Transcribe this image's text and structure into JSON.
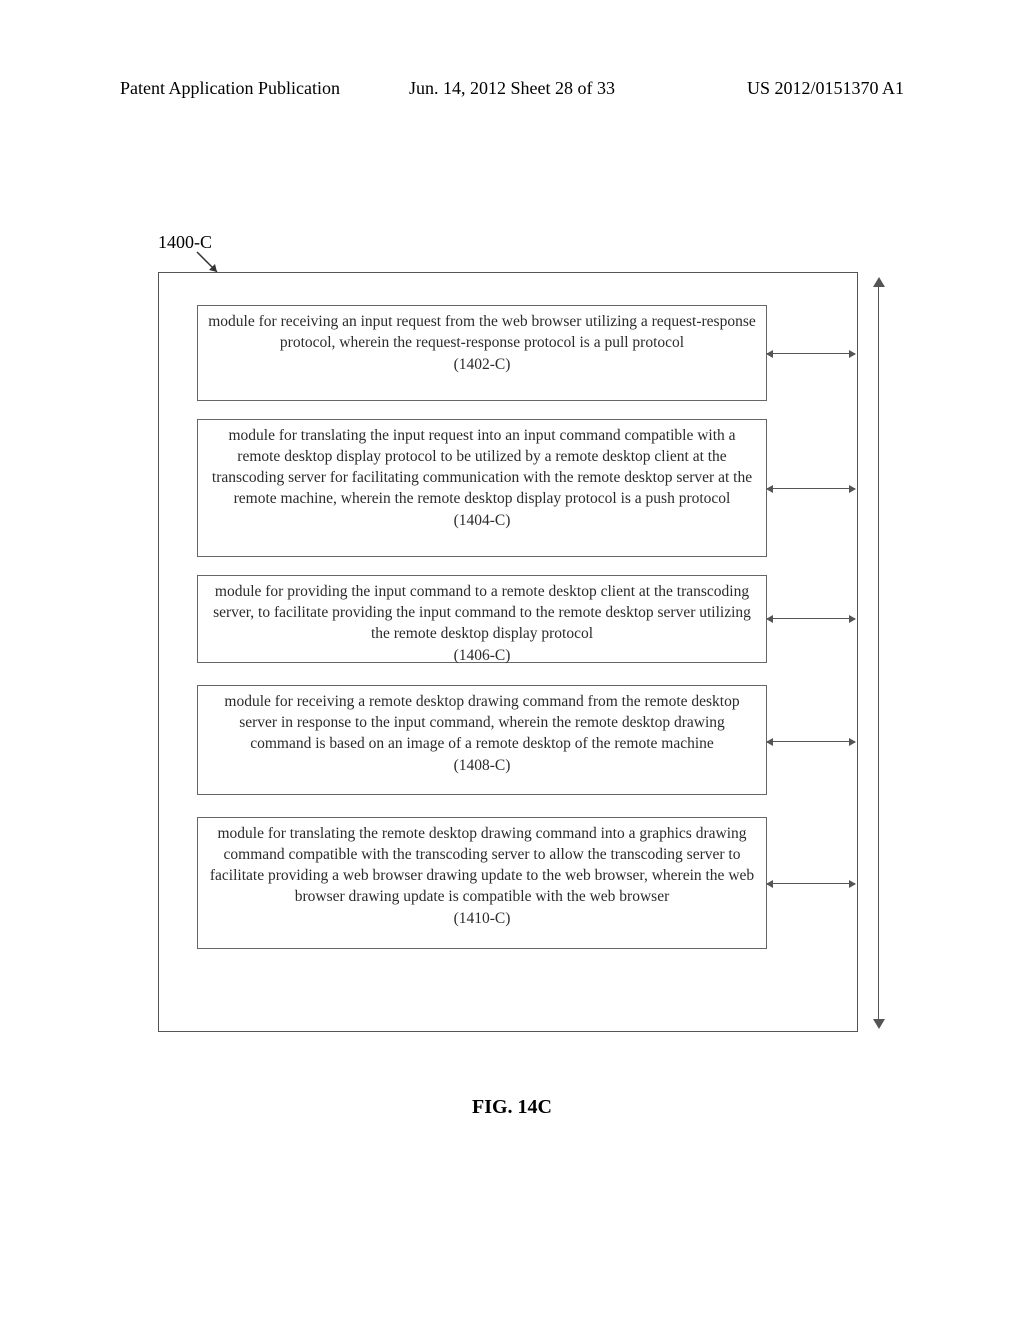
{
  "header": {
    "left": "Patent Application Publication",
    "center": "Jun. 14, 2012  Sheet 28 of 33",
    "right": "US 2012/0151370 A1"
  },
  "diagram": {
    "label": "1400-C",
    "modules": [
      {
        "text": "module for receiving an input request from the web browser utilizing a request-response protocol, wherein the request-response protocol is a pull protocol",
        "ref": "(1402-C)"
      },
      {
        "text": "module for translating the input request into an input command compatible with a remote desktop display protocol to be utilized by a remote desktop client at the transcoding server for facilitating communication with the remote desktop server at the remote machine, wherein the remote desktop display protocol is a push protocol",
        "ref": "(1404-C)"
      },
      {
        "text": "module for providing the input command to a remote desktop client at the transcoding server, to facilitate providing the input command to the remote desktop server utilizing the remote desktop display protocol",
        "ref": "(1406-C)"
      },
      {
        "text": "module for receiving a remote desktop drawing command from the remote desktop server in response to the input command, wherein the remote desktop drawing command is based on an image of a remote desktop of the remote machine",
        "ref": "(1408-C)"
      },
      {
        "text": "module for translating the remote desktop drawing command into a graphics drawing command compatible with the transcoding server to allow the transcoding server to facilitate providing a web browser drawing update to the web browser, wherein the web browser drawing update is compatible with the web browser",
        "ref": "(1410-C)"
      }
    ]
  },
  "figure_caption": "FIG. 14C"
}
